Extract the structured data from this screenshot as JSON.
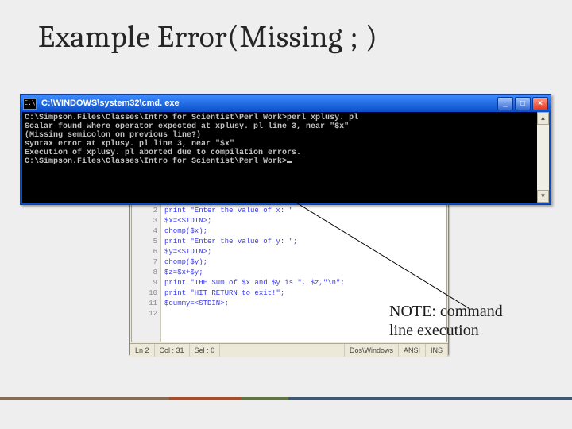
{
  "title": "Example Error(Missing ; )",
  "cmd": {
    "icon_text": "C:\\",
    "window_title": "C:\\WINDOWS\\system32\\cmd. exe",
    "btn_min": "_",
    "btn_max": "□",
    "btn_close": "×",
    "lines": {
      "l0": "C:\\Simpson.Files\\Classes\\Intro for Scientist\\Perl Work>perl xplusy. pl",
      "l1": "Scalar found where operator expected at xplusy. pl line 3, near \"$x\"",
      "l2": "      (Missing semicolon on previous line?)",
      "l3": "syntax error at xplusy. pl line 3, near \"$x\"",
      "l4": "Execution of xplusy. pl aborted due to compilation errors.",
      "l5": "",
      "l6": "C:\\Simpson.Files\\Classes\\Intro for Scientist\\Perl Work>"
    }
  },
  "editor": {
    "gutter": {
      "n2": "2",
      "n3": "3",
      "n4": "4",
      "n5": "5",
      "n6": "6",
      "n7": "7",
      "n8": "8",
      "n9": "9",
      "n10": "10",
      "n11": "11",
      "n12": "12"
    },
    "code": {
      "c2": "print \"Enter the value of x: \"",
      "c3": "$x=<STDIN>;",
      "c4": "chomp($x);",
      "c5": "print \"Enter the value of y: \";",
      "c6": "$y=<STDIN>;",
      "c7": "chomp($y);",
      "c8": "$z=$x+$y;",
      "c9": "print \"THE Sum of $x and $y is \", $z,\"\\n\";",
      "c10": "print \"HIT RETURN to exit!\";",
      "c11": "$dummy=<STDIN>;",
      "c12": ""
    },
    "status": {
      "ln": "Ln  2",
      "col": "Col : 31",
      "sel": "Sel : 0",
      "fmt": "Dos\\Windows",
      "enc": "ANSI",
      "ins": "INS"
    }
  },
  "note": {
    "l1": "NOTE: command",
    "l2": "line execution"
  }
}
